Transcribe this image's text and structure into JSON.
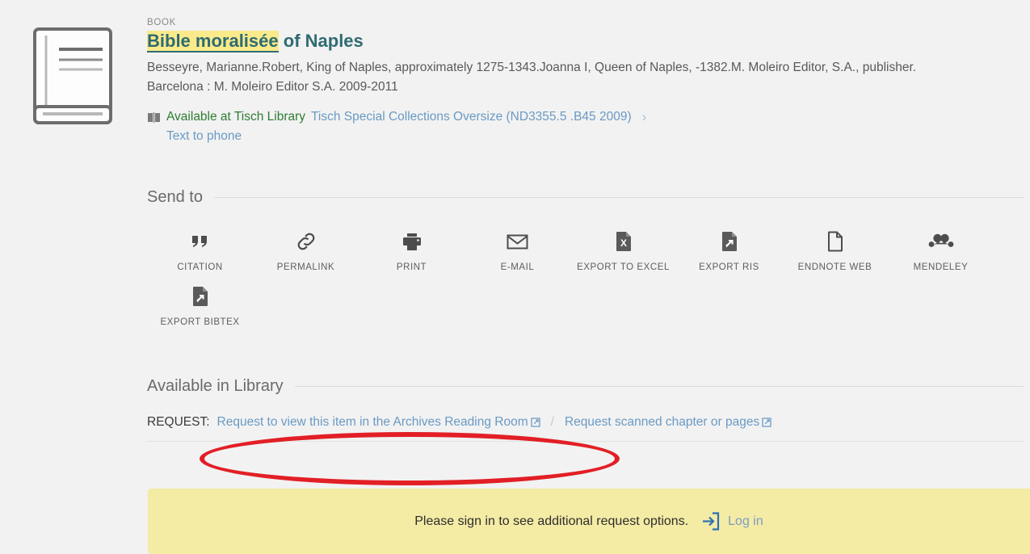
{
  "record": {
    "type_label": "BOOK",
    "title_highlight": "Bible moralisée",
    "title_rest": " of Naples",
    "authors": "Besseyre, Marianne.Robert, King of Naples, approximately 1275-1343.Joanna I, Queen of Naples, -1382.M. Moleiro Editor, S.A., publisher.",
    "publication": "Barcelona : M. Moleiro Editor S.A. 2009-2011",
    "availability_status": "Available at Tisch Library",
    "availability_location": "Tisch Special Collections Oversize (ND3355.5 .B45 2009)",
    "chevron": "›",
    "text_to_phone": "Text to phone",
    "thumbnail_icon": "book-placeholder-icon",
    "availability_icon": "open-book-icon"
  },
  "send_to": {
    "section_title": "Send to",
    "items": [
      {
        "label": "CITATION",
        "icon": "quote-icon"
      },
      {
        "label": "PERMALINK",
        "icon": "link-icon"
      },
      {
        "label": "PRINT",
        "icon": "printer-icon"
      },
      {
        "label": "E-MAIL",
        "icon": "envelope-icon"
      },
      {
        "label": "EXPORT TO EXCEL",
        "icon": "excel-file-icon"
      },
      {
        "label": "EXPORT RIS",
        "icon": "export-file-icon"
      },
      {
        "label": "ENDNOTE WEB",
        "icon": "document-icon"
      },
      {
        "label": "MENDELEY",
        "icon": "mendeley-icon"
      },
      {
        "label": "EXPORT BIBTEX",
        "icon": "export-file-icon"
      }
    ]
  },
  "available_in_library": {
    "section_title": "Available in Library",
    "request_label": "REQUEST:",
    "links": [
      {
        "label": "Request to view this item in the Archives Reading Room",
        "icon": "external-link-icon"
      },
      {
        "label": "Request scanned chapter or pages",
        "icon": "external-link-icon"
      }
    ],
    "separator": "/"
  },
  "sign_in_banner": {
    "message": "Please sign in to see additional request options.",
    "login_label": "Log in",
    "login_icon": "sign-in-icon",
    "background_color": "#f4eba5"
  },
  "annotation": {
    "shape": "ellipse",
    "color": "#e21f26",
    "targets": "request-to-view-archives-reading-room-link"
  },
  "colors": {
    "page_background": "#f2f2f2",
    "title_color": "#2e6b72",
    "link_color": "#6a9ac4",
    "available_color": "#2e7d32",
    "highlight_color": "#faea8a"
  }
}
